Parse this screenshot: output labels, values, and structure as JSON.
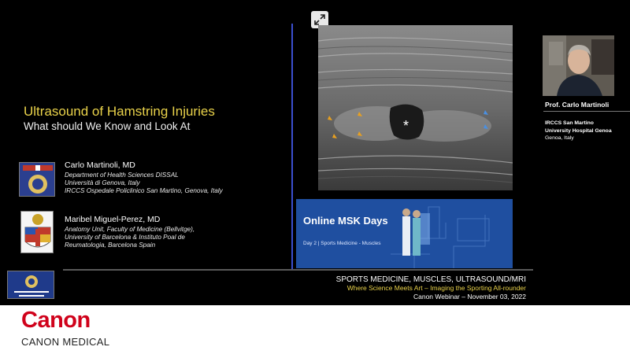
{
  "slide": {
    "title": "Ultrasound of Hamstring Injuries",
    "subtitle": "What should We Know and Look At",
    "authors": [
      {
        "name": "Carlo Martinoli, MD",
        "affiliations": [
          "Department of Health Sciences DISSAL",
          "Università di Genova, Italy",
          "IRCCS Ospedale Policlinico San Martino, Genova, Italy"
        ]
      },
      {
        "name": "Maribel Miguel-Perez, MD",
        "affiliations": [
          "Anatomy Unit, Faculty of Medicine (Bellvitge),",
          "University of Barcelona & Instituto Poal de",
          "Reumatologia, Barcelona Spain"
        ]
      }
    ],
    "image_label": "*",
    "promo": {
      "title": "Online MSK Days",
      "subtitle": "Day 2 | Sports Medicine - Muscles"
    },
    "footer": {
      "line1": "SPORTS MEDICINE, MUSCLES, ULTRASOUND/MRI",
      "line2": "Where Science Meets Art – Imaging the Sporting All-rounder",
      "line3": "Canon Webinar – November 03, 2022"
    }
  },
  "speaker": {
    "name": "Prof. Carlo Martinoli",
    "institution_line1": "IRCCS San Martino",
    "institution_line2": "University Hospital Genoa",
    "location": "Genoa, Italy"
  },
  "brand": {
    "logo": "Canon",
    "sub": "CANON MEDICAL",
    "color": "#d0021b"
  },
  "colors": {
    "title": "#e9d24a",
    "divider": "#3b4fd0",
    "promo_bg": "#1f4fa0"
  },
  "icons": {
    "expand": "expand-arrows-icon"
  }
}
